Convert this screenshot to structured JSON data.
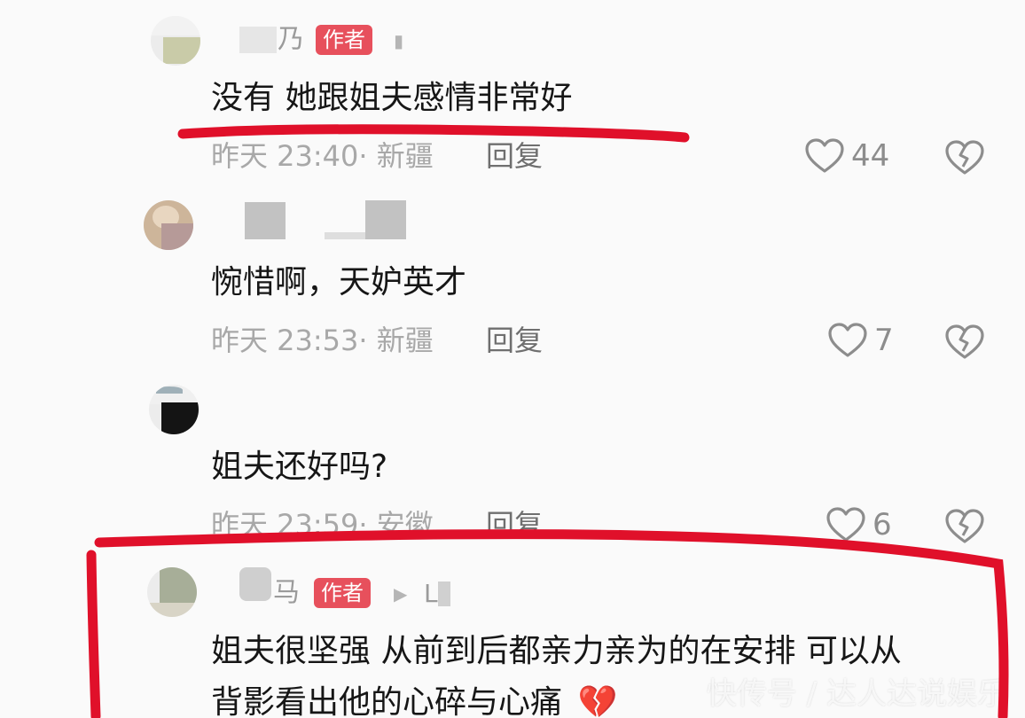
{
  "comments": [
    {
      "username_visible": "乃",
      "author_badge": "作者",
      "content": "没有 她跟姐夫感情非常好",
      "time": "昨天 23:40",
      "location": "新疆",
      "reply_label": "回复",
      "likes": "44"
    },
    {
      "content": "惋惜啊，天妒英才",
      "time": "昨天 23:53",
      "location": "新疆",
      "reply_label": "回复",
      "likes": "7"
    },
    {
      "content": "姐夫还好吗?",
      "time": "昨天 23:59",
      "location": "安徽",
      "reply_label": "回复",
      "likes": "6"
    },
    {
      "username_visible": "马",
      "author_badge": "作者",
      "reply_to": "L",
      "content_line1": "姐夫很坚强 从前到后都亲力亲为的在安排 可以从",
      "content_line2": "背影看出他的心碎与心痛",
      "emoji": "💔"
    }
  ],
  "watermark": "快传号 / 达人达说娱乐",
  "colors": {
    "annotation_red": "#e0102a",
    "badge": "#e7505c",
    "meta_text": "#a8a8a8"
  },
  "icons": {
    "like": "heart-outline-icon",
    "dislike": "broken-heart-icon"
  }
}
